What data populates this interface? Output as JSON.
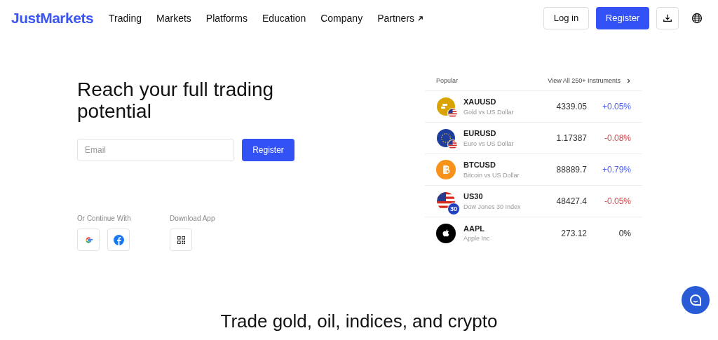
{
  "nav": {
    "logo": "JustMarkets",
    "items": [
      {
        "label": "Trading",
        "external": false
      },
      {
        "label": "Markets",
        "external": false
      },
      {
        "label": "Platforms",
        "external": false
      },
      {
        "label": "Education",
        "external": false
      },
      {
        "label": "Company",
        "external": false
      },
      {
        "label": "Partners",
        "external": true
      }
    ],
    "login": "Log in",
    "register": "Register"
  },
  "hero": {
    "title": "Reach your full trading potential",
    "email_placeholder": "Email",
    "register": "Register",
    "continue_label": "Or Continue With",
    "download_label": "Download App"
  },
  "popular": {
    "title": "Popular",
    "view_all": "View All 250+ Instruments",
    "rows": [
      {
        "kind": "gold",
        "symbol": "XAUUSD",
        "name": "Gold vs US Dollar",
        "price": "4339.05",
        "change": "+0.05%",
        "color": "#4a5cf0"
      },
      {
        "kind": "euro",
        "symbol": "EURUSD",
        "name": "Euro vs US Dollar",
        "price": "1.17387",
        "change": "-0.08%",
        "color": "#d0454c"
      },
      {
        "kind": "bitcoin",
        "symbol": "BTCUSD",
        "name": "Bitcoin vs US Dollar",
        "price": "88889.7",
        "change": "+0.79%",
        "color": "#4a5cf0"
      },
      {
        "kind": "index",
        "symbol": "US30",
        "name": "Dow Jones 30 Index",
        "price": "48427.4",
        "change": "-0.05%",
        "color": "#d0454c",
        "badge": "30"
      },
      {
        "kind": "stock",
        "symbol": "AAPL",
        "name": "Apple Inc",
        "price": "273.12",
        "change": "0%"
      }
    ]
  },
  "section_title": "Trade gold, oil, indices, and crypto"
}
